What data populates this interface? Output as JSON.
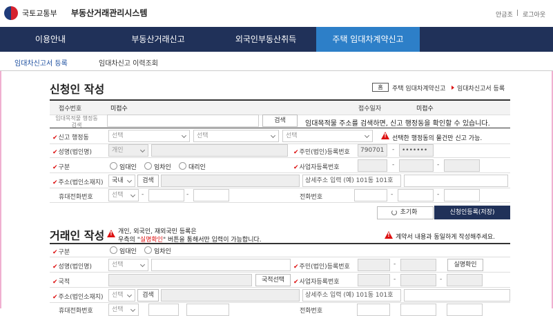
{
  "header": {
    "ministry": "국토교통부",
    "system_title": "부동산거래관리시스템",
    "user_name": "안금조",
    "logout": "로그아웃",
    "divider": "|"
  },
  "nav": {
    "items": [
      "이용안내",
      "부동산거래신고",
      "외국인부동산취득",
      "주택 임대차계약신고"
    ],
    "active_index": 3
  },
  "subnav": {
    "items": [
      "임대차신고서 등록",
      "임대차신고 이력조회"
    ]
  },
  "applicant": {
    "title": "신청인 작성",
    "breadcrumb": {
      "home": "홈",
      "items": [
        "주택 임대차계약신고",
        "임대차신고서 등록"
      ]
    },
    "receipt_no_label": "접수번호",
    "receipt_no_value": "미접수",
    "receipt_date_label": "접수일자",
    "receipt_date_value": "미접수",
    "rental_purpose_label": "임대목적물 행정동 검색",
    "search_btn": "검색",
    "search_note": "임대목적물 주소를 검색하면, 신고 행정동을 확인할 수 있습니다.",
    "district_label": "신고 행정동",
    "select_placeholder": "선택",
    "district_warning": "선택한 행정동의 물건만 신고 가능.",
    "name_label": "성명(법인명)",
    "name_type": "개인",
    "resident_no_label": "주민(법인)등록번호",
    "resident_no_front": "790701",
    "resident_no_back": "•••••••",
    "category_label": "구분",
    "categories": [
      "임대인",
      "임차인",
      "대리인"
    ],
    "business_no_label": "사업자등록번호",
    "address_label": "주소(법인소재지)",
    "address_country": "국내",
    "address_search_btn": "검색",
    "detail_address_placeholder": "상세주소 입력 (예) 101동 101호",
    "mobile_label": "휴대전화번호",
    "phone_label": "전화번호",
    "reset_btn": "초기화",
    "register_btn": "신청인등록(저장)"
  },
  "transaction": {
    "title": "거래인 작성",
    "notice_line1": "개인, 외국인, 재외국민 등록은",
    "notice_line2_pre": "우측의 \"",
    "notice_line2_red": "실명확인",
    "notice_line2_post": "\" 버튼을 통해서만 입력이 가능합니다.",
    "contract_note": "계약서 내용과 동일하게 작성해주세요.",
    "category_label": "구분",
    "categories": [
      "임대인",
      "임차인"
    ],
    "name_label": "성명(법인명)",
    "select_placeholder": "선택",
    "resident_no_label": "주민(법인)등록번호",
    "realname_btn": "실명확인",
    "nationality_label": "국적",
    "nationality_btn": "국적선택",
    "business_no_label": "사업자등록번호",
    "address_label": "주소(법인소재지)",
    "address_search_btn": "검색",
    "detail_address_placeholder": "상세주소 입력 (예) 101동 101호",
    "mobile_label": "휴대전화번호",
    "phone_label": "전화번호"
  }
}
